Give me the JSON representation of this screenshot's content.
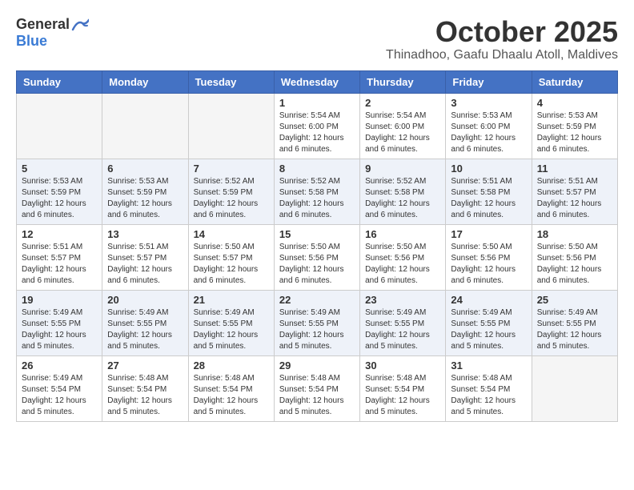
{
  "header": {
    "logo": {
      "general": "General",
      "blue": "Blue"
    },
    "month": "October 2025",
    "location": "Thinadhoo, Gaafu Dhaalu Atoll, Maldives"
  },
  "weekdays": [
    "Sunday",
    "Monday",
    "Tuesday",
    "Wednesday",
    "Thursday",
    "Friday",
    "Saturday"
  ],
  "weeks": [
    [
      {
        "day": "",
        "info": ""
      },
      {
        "day": "",
        "info": ""
      },
      {
        "day": "",
        "info": ""
      },
      {
        "day": "1",
        "info": "Sunrise: 5:54 AM\nSunset: 6:00 PM\nDaylight: 12 hours\nand 6 minutes."
      },
      {
        "day": "2",
        "info": "Sunrise: 5:54 AM\nSunset: 6:00 PM\nDaylight: 12 hours\nand 6 minutes."
      },
      {
        "day": "3",
        "info": "Sunrise: 5:53 AM\nSunset: 6:00 PM\nDaylight: 12 hours\nand 6 minutes."
      },
      {
        "day": "4",
        "info": "Sunrise: 5:53 AM\nSunset: 5:59 PM\nDaylight: 12 hours\nand 6 minutes."
      }
    ],
    [
      {
        "day": "5",
        "info": "Sunrise: 5:53 AM\nSunset: 5:59 PM\nDaylight: 12 hours\nand 6 minutes."
      },
      {
        "day": "6",
        "info": "Sunrise: 5:53 AM\nSunset: 5:59 PM\nDaylight: 12 hours\nand 6 minutes."
      },
      {
        "day": "7",
        "info": "Sunrise: 5:52 AM\nSunset: 5:59 PM\nDaylight: 12 hours\nand 6 minutes."
      },
      {
        "day": "8",
        "info": "Sunrise: 5:52 AM\nSunset: 5:58 PM\nDaylight: 12 hours\nand 6 minutes."
      },
      {
        "day": "9",
        "info": "Sunrise: 5:52 AM\nSunset: 5:58 PM\nDaylight: 12 hours\nand 6 minutes."
      },
      {
        "day": "10",
        "info": "Sunrise: 5:51 AM\nSunset: 5:58 PM\nDaylight: 12 hours\nand 6 minutes."
      },
      {
        "day": "11",
        "info": "Sunrise: 5:51 AM\nSunset: 5:57 PM\nDaylight: 12 hours\nand 6 minutes."
      }
    ],
    [
      {
        "day": "12",
        "info": "Sunrise: 5:51 AM\nSunset: 5:57 PM\nDaylight: 12 hours\nand 6 minutes."
      },
      {
        "day": "13",
        "info": "Sunrise: 5:51 AM\nSunset: 5:57 PM\nDaylight: 12 hours\nand 6 minutes."
      },
      {
        "day": "14",
        "info": "Sunrise: 5:50 AM\nSunset: 5:57 PM\nDaylight: 12 hours\nand 6 minutes."
      },
      {
        "day": "15",
        "info": "Sunrise: 5:50 AM\nSunset: 5:56 PM\nDaylight: 12 hours\nand 6 minutes."
      },
      {
        "day": "16",
        "info": "Sunrise: 5:50 AM\nSunset: 5:56 PM\nDaylight: 12 hours\nand 6 minutes."
      },
      {
        "day": "17",
        "info": "Sunrise: 5:50 AM\nSunset: 5:56 PM\nDaylight: 12 hours\nand 6 minutes."
      },
      {
        "day": "18",
        "info": "Sunrise: 5:50 AM\nSunset: 5:56 PM\nDaylight: 12 hours\nand 6 minutes."
      }
    ],
    [
      {
        "day": "19",
        "info": "Sunrise: 5:49 AM\nSunset: 5:55 PM\nDaylight: 12 hours\nand 5 minutes."
      },
      {
        "day": "20",
        "info": "Sunrise: 5:49 AM\nSunset: 5:55 PM\nDaylight: 12 hours\nand 5 minutes."
      },
      {
        "day": "21",
        "info": "Sunrise: 5:49 AM\nSunset: 5:55 PM\nDaylight: 12 hours\nand 5 minutes."
      },
      {
        "day": "22",
        "info": "Sunrise: 5:49 AM\nSunset: 5:55 PM\nDaylight: 12 hours\nand 5 minutes."
      },
      {
        "day": "23",
        "info": "Sunrise: 5:49 AM\nSunset: 5:55 PM\nDaylight: 12 hours\nand 5 minutes."
      },
      {
        "day": "24",
        "info": "Sunrise: 5:49 AM\nSunset: 5:55 PM\nDaylight: 12 hours\nand 5 minutes."
      },
      {
        "day": "25",
        "info": "Sunrise: 5:49 AM\nSunset: 5:55 PM\nDaylight: 12 hours\nand 5 minutes."
      }
    ],
    [
      {
        "day": "26",
        "info": "Sunrise: 5:49 AM\nSunset: 5:54 PM\nDaylight: 12 hours\nand 5 minutes."
      },
      {
        "day": "27",
        "info": "Sunrise: 5:48 AM\nSunset: 5:54 PM\nDaylight: 12 hours\nand 5 minutes."
      },
      {
        "day": "28",
        "info": "Sunrise: 5:48 AM\nSunset: 5:54 PM\nDaylight: 12 hours\nand 5 minutes."
      },
      {
        "day": "29",
        "info": "Sunrise: 5:48 AM\nSunset: 5:54 PM\nDaylight: 12 hours\nand 5 minutes."
      },
      {
        "day": "30",
        "info": "Sunrise: 5:48 AM\nSunset: 5:54 PM\nDaylight: 12 hours\nand 5 minutes."
      },
      {
        "day": "31",
        "info": "Sunrise: 5:48 AM\nSunset: 5:54 PM\nDaylight: 12 hours\nand 5 minutes."
      },
      {
        "day": "",
        "info": ""
      }
    ]
  ]
}
